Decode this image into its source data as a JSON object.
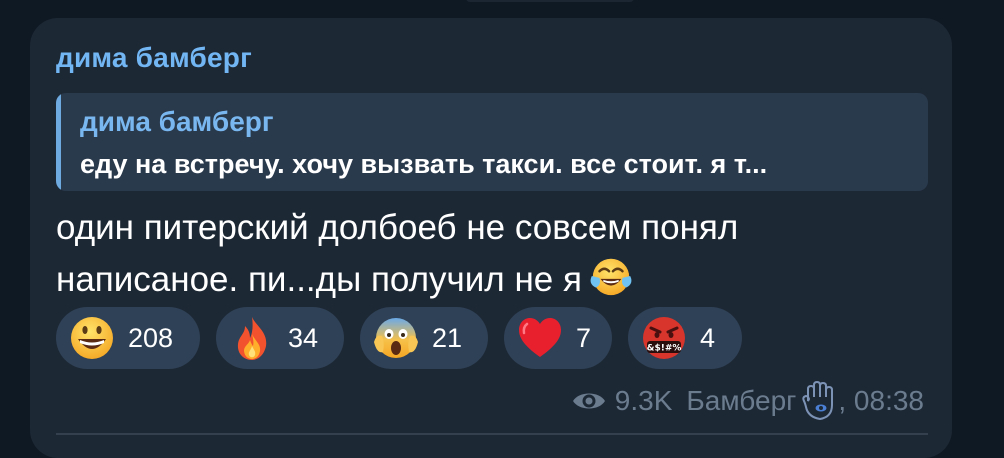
{
  "post": {
    "sender_name": "дима бамберг",
    "reply": {
      "author": "дима бамберг",
      "text": "еду на встречу. хочу вызвать такси. все стоит. я т..."
    },
    "message_text": "один питерский долбоеб не совсем понял написаное. пи...ды получил не я",
    "message_emoji": "face-with-tears-of-joy",
    "reactions": [
      {
        "emoji": "grinning-face-with-big-eyes",
        "count": "208"
      },
      {
        "emoji": "fire",
        "count": "34"
      },
      {
        "emoji": "face-screaming-in-fear",
        "count": "21"
      },
      {
        "emoji": "red-heart",
        "count": "7"
      },
      {
        "emoji": "face-with-symbols-on-mouth",
        "count": "4"
      }
    ],
    "footer": {
      "views": "9.3K",
      "author_signature": "Бамберг",
      "signature_icon": "hamsa-icon",
      "time": ", 08:38"
    }
  },
  "colors": {
    "background": "#0f1924",
    "bubble": "#1d2835",
    "accent": "#72b6f4",
    "reaction_pill": "#2f4156",
    "meta_text": "#6b7c8f"
  }
}
